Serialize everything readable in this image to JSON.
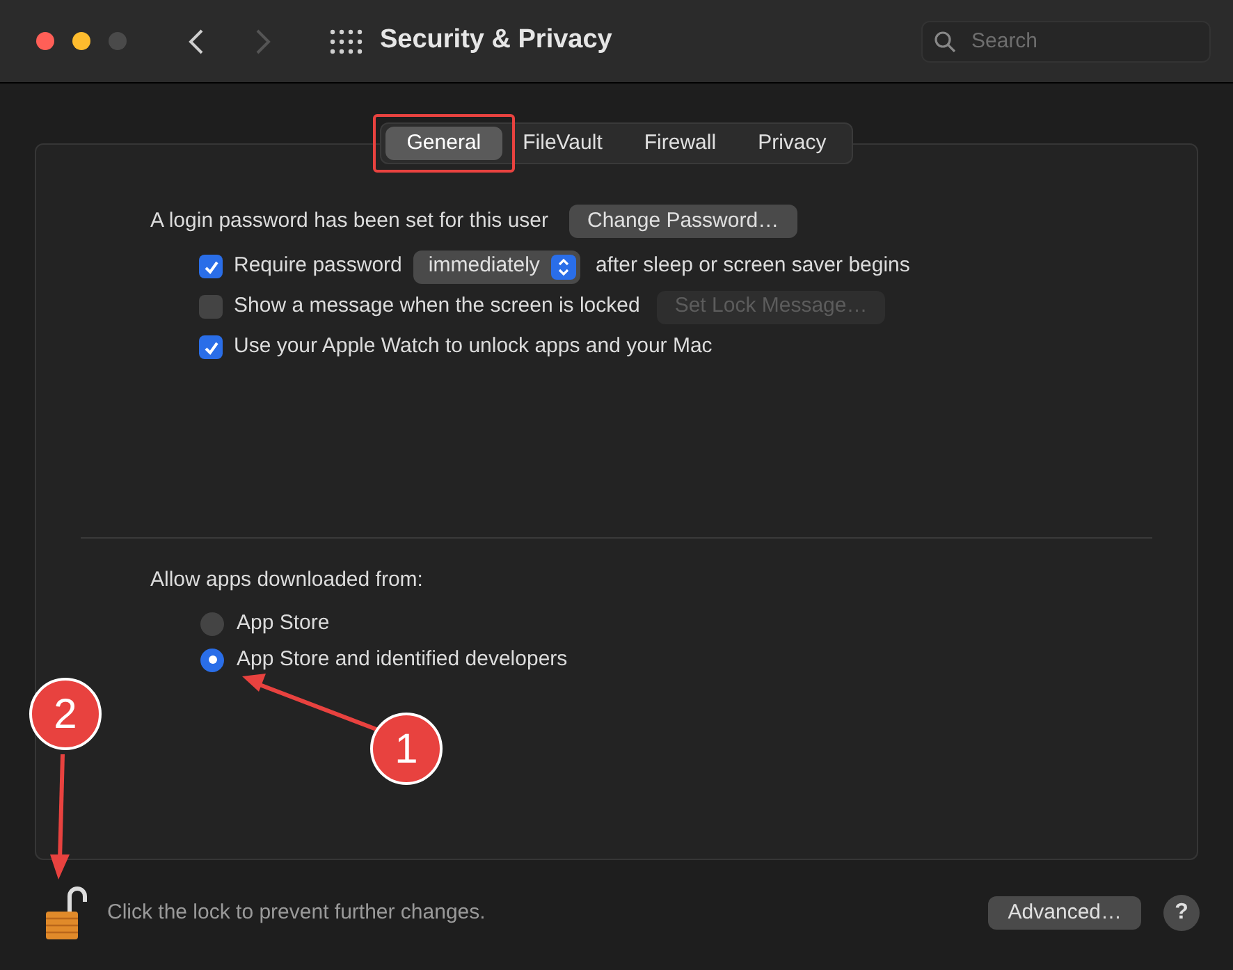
{
  "window": {
    "title": "Security & Privacy",
    "search": {
      "placeholder": "Search"
    }
  },
  "tabs": [
    {
      "label": "General",
      "selected": true,
      "highlighted": true
    },
    {
      "label": "FileVault",
      "selected": false,
      "highlighted": false
    },
    {
      "label": "Firewall",
      "selected": false,
      "highlighted": false
    },
    {
      "label": "Privacy",
      "selected": false,
      "highlighted": false
    }
  ],
  "login": {
    "text": "A login password has been set for this user",
    "button": "Change Password…"
  },
  "options": [
    {
      "kind": "popup",
      "checked": true,
      "label": "Require password",
      "popup": "immediately",
      "suffix": "after sleep or screen saver begins"
    },
    {
      "kind": "button",
      "checked": false,
      "label": "Show a message when the screen is locked",
      "button": "Set Lock Message…",
      "disabled": true
    },
    {
      "kind": "plain",
      "checked": true,
      "label": "Use your Apple Watch to unlock apps and your Mac"
    }
  ],
  "allow": {
    "heading": "Allow apps downloaded from:",
    "choices": [
      {
        "label": "App Store",
        "selected": false
      },
      {
        "label": "App Store and identified developers",
        "selected": true
      }
    ]
  },
  "footer": {
    "unlocked": true,
    "lock_text": "Click the lock to prevent further changes.",
    "advanced": "Advanced…",
    "help": "?"
  },
  "annotations": [
    {
      "label": "1"
    },
    {
      "label": "2"
    }
  ]
}
